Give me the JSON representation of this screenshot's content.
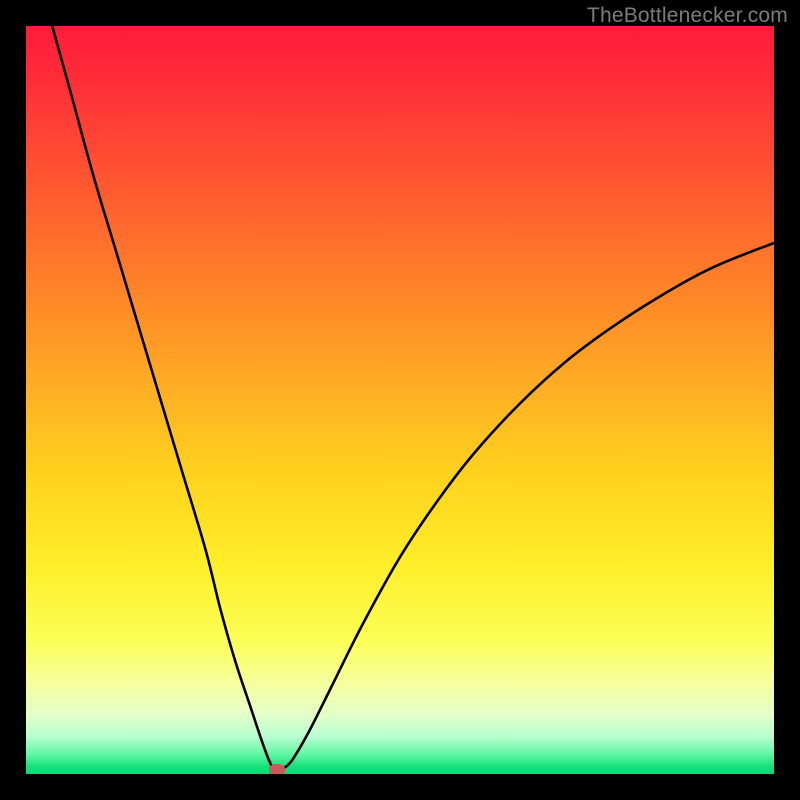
{
  "watermark": "TheBottlenecker.com",
  "chart_data": {
    "type": "line",
    "title": "",
    "xlabel": "",
    "ylabel": "",
    "xlim": [
      0,
      100
    ],
    "ylim": [
      0,
      100
    ],
    "series": [
      {
        "name": "bottleneck-curve",
        "x": [
          3.5,
          6,
          9,
          12,
          15,
          18,
          21,
          24,
          26,
          28,
          30,
          31.5,
          32.5,
          33.2,
          34,
          35,
          36,
          38,
          41,
          45,
          50,
          55,
          60,
          66,
          72,
          78,
          85,
          92,
          100
        ],
        "y": [
          100,
          91,
          80,
          70,
          60,
          50,
          40,
          30,
          22,
          15,
          9,
          4.5,
          1.8,
          0.6,
          0.6,
          1.2,
          2.5,
          6,
          12,
          20,
          29,
          36.5,
          43,
          49.5,
          55,
          59.5,
          64,
          67.8,
          71
        ]
      }
    ],
    "marker": {
      "x": 33.6,
      "y": 0.6,
      "color": "#c95c58"
    },
    "gradient_stops": [
      {
        "pos": 0,
        "color": "#ff1b3b"
      },
      {
        "pos": 50,
        "color": "#ffd21e"
      },
      {
        "pos": 90,
        "color": "#f6ffa0"
      },
      {
        "pos": 100,
        "color": "#0fd874"
      }
    ]
  }
}
